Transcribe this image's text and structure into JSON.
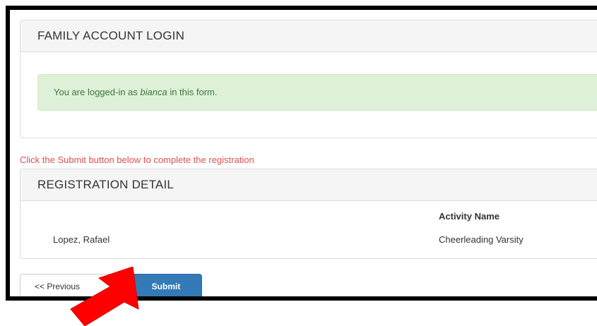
{
  "login_panel": {
    "title": "FAMILY ACCOUNT LOGIN",
    "alert_prefix": "You are logged-in as ",
    "alert_user": "bianca",
    "alert_suffix": " in this form."
  },
  "instruction": "Click the Submit button below to complete the registration",
  "registration_panel": {
    "title": "REGISTRATION DETAIL",
    "column_header": "Activity Name",
    "participant_name": "Lopez, Rafael",
    "activity_name": "Cheerleading Varsity"
  },
  "buttons": {
    "previous_label": "<< Previous",
    "submit_label": "Submit"
  },
  "colors": {
    "alert_background": "#dff0d8",
    "alert_text": "#3c763d",
    "instruction_text": "#d9534f",
    "submit_button": "#337ab7",
    "annotation_arrow": "#ff0000"
  },
  "icons": {
    "annotation": "red-arrow-icon"
  }
}
